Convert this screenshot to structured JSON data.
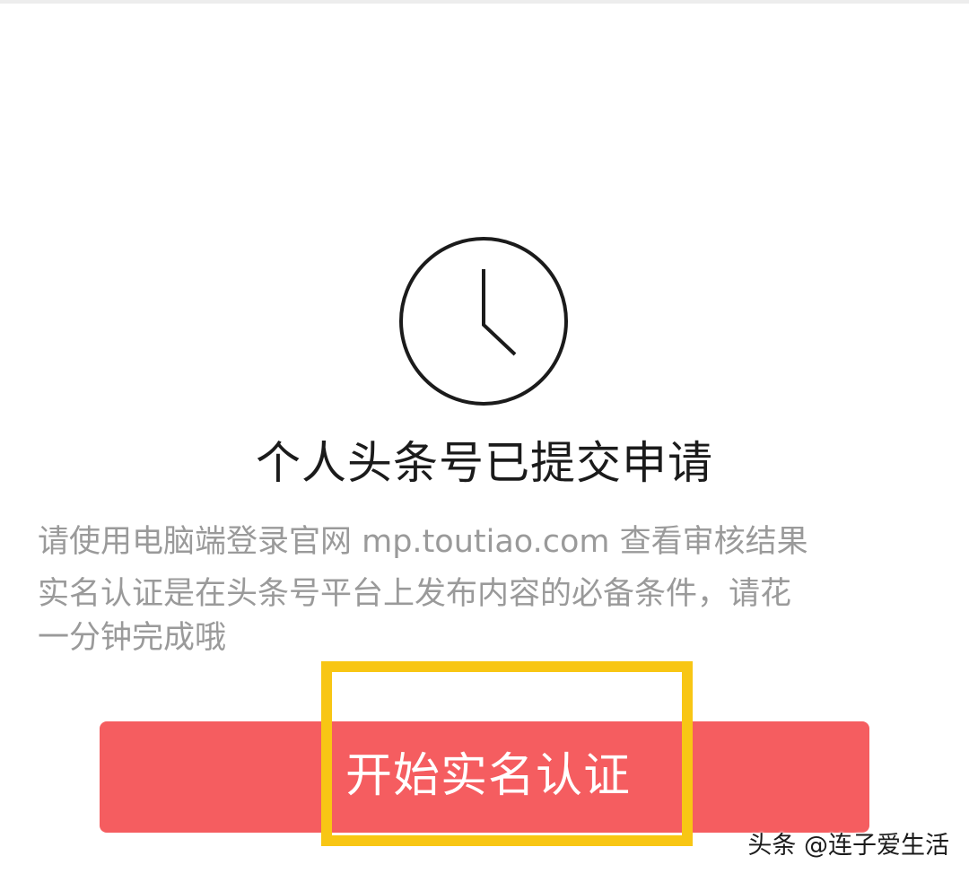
{
  "status": {
    "icon": "clock-icon",
    "title": "个人头条号已提交申请"
  },
  "description": {
    "line1": "请使用电脑端登录官网 mp.toutiao.com 查看审核结果",
    "line2": "实名认证是在头条号平台上发布内容的必备条件，请花",
    "line3": "一分钟完成哦"
  },
  "actions": {
    "start_verification_label": "开始实名认证"
  },
  "watermark": {
    "text": "头条 @连子爱生活"
  },
  "colors": {
    "button_bg": "#f55d60",
    "highlight_border": "#f8c614",
    "title_text": "#1b1b1b",
    "description_text": "#9a9a9a"
  }
}
